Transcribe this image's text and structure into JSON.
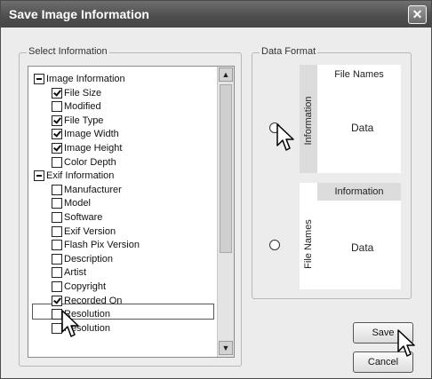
{
  "window": {
    "title": "Save Image Information",
    "close_glyph": "✕"
  },
  "select_group": {
    "label": "Select Information",
    "items": [
      {
        "label": "Image Information",
        "state": "minus",
        "level": 0
      },
      {
        "label": "File Size",
        "state": "checked",
        "level": 1
      },
      {
        "label": "Modified",
        "state": "unchecked",
        "level": 1
      },
      {
        "label": "File Type",
        "state": "checked",
        "level": 1
      },
      {
        "label": "Image Width",
        "state": "checked",
        "level": 1
      },
      {
        "label": "Image Height",
        "state": "checked",
        "level": 1
      },
      {
        "label": "Color Depth",
        "state": "unchecked",
        "level": 1
      },
      {
        "label": "Exif Information",
        "state": "minus",
        "level": 0
      },
      {
        "label": "Manufacturer",
        "state": "unchecked",
        "level": 1
      },
      {
        "label": "Model",
        "state": "unchecked",
        "level": 1
      },
      {
        "label": "Software",
        "state": "unchecked",
        "level": 1
      },
      {
        "label": "Exif Version",
        "state": "unchecked",
        "level": 1
      },
      {
        "label": "Flash Pix Version",
        "state": "unchecked",
        "level": 1
      },
      {
        "label": "Description",
        "state": "unchecked",
        "level": 1
      },
      {
        "label": "Artist",
        "state": "unchecked",
        "level": 1
      },
      {
        "label": "Copyright",
        "state": "unchecked",
        "level": 1
      },
      {
        "label": "Recorded On",
        "state": "checked",
        "level": 1,
        "highlighted": true
      },
      {
        "label": "Resolution",
        "state": "unchecked",
        "level": 1
      },
      {
        "label": "Resolution",
        "state": "unchecked",
        "level": 1
      }
    ]
  },
  "data_format": {
    "label": "Data Format",
    "option1": {
      "header": "File Names",
      "side": "Information",
      "body": "Data",
      "selected": true
    },
    "option2": {
      "header": "Information",
      "side": "File Names",
      "body": "Data",
      "selected": false
    }
  },
  "buttons": {
    "save": "Save",
    "cancel": "Cancel"
  },
  "icons": {
    "cursor": "arrow-cursor-icon",
    "close": "close-icon",
    "scroll_up": "▲",
    "scroll_down": "▼"
  }
}
